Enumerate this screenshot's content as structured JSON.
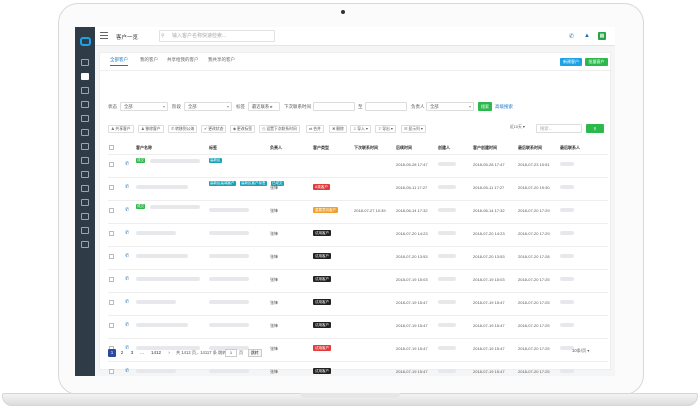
{
  "window": {
    "title": "客户一览",
    "search_placeholder": "输入客户名称快速检索..."
  },
  "header_icons": [
    "phone-icon",
    "bell-icon",
    "calendar-icon"
  ],
  "tabs": [
    {
      "label": "全部客户",
      "active": true
    },
    {
      "label": "我的客户",
      "active": false
    },
    {
      "label": "共享给我的客户",
      "active": false
    },
    {
      "label": "我共享的客户",
      "active": false
    }
  ],
  "actions": {
    "new_customer": "新建客户",
    "import_customer": "批量客户"
  },
  "filters": {
    "status_label": "状态",
    "status_value": "全部",
    "stage_label": "阶段",
    "stage_value": "全部",
    "tag_label": "标签",
    "tag_value": "最近联系 ▸",
    "next_contact_label": "下次联系时间",
    "to": "至",
    "owner_label": "负责人",
    "owner_value": "全部",
    "search_btn": "搜索",
    "advanced": "高级搜索"
  },
  "toolbar": [
    {
      "icon": "person-icon",
      "label": "共享客户"
    },
    {
      "icon": "person-icon",
      "label": "移除客户"
    },
    {
      "icon": "phone-icon",
      "label": "转移到公海"
    },
    {
      "icon": "check-icon",
      "label": "更改状态"
    },
    {
      "icon": "tag-icon",
      "label": "更改标签"
    },
    {
      "icon": "clock-icon",
      "label": "设置下次联系时间"
    },
    {
      "icon": "merge-icon",
      "label": "合并"
    },
    {
      "icon": "trash-icon",
      "label": "删除"
    },
    {
      "icon": "import-icon",
      "label": "导入"
    },
    {
      "icon": "export-icon",
      "label": "导出"
    },
    {
      "icon": "list-icon",
      "label": "显示列"
    }
  ],
  "view": {
    "sort_label": "近10天 ▾",
    "search_placeholder": "搜索..."
  },
  "columns": [
    "客户名称",
    "标签",
    "负责人",
    "客户类型",
    "下次联系时间",
    "后续时间",
    "创建人",
    "客户创建时间",
    "最后联系时间",
    "最后联系人"
  ],
  "rows": [
    {
      "name_tag": "成交",
      "name_tag_color": "#2db84b",
      "tags": [
        {
          "t": "高新区",
          "c": "#17a2b8"
        }
      ],
      "owner": "",
      "stage": "",
      "stage_color": "",
      "next": "",
      "follow": "2018-05-28 17:47",
      "creator": "",
      "created": "2018-05-28 17:47",
      "last": "2018-07-23 10:51",
      "label_blur": 0
    },
    {
      "name_tag": "",
      "name_tag_color": "",
      "tags": [
        {
          "t": "高新区高端客户",
          "c": "#17a2b8"
        },
        {
          "t": "高新区客户标签",
          "c": "#17a2b8"
        },
        {
          "t": "已成交",
          "c": "#17a2b8"
        }
      ],
      "owner": "张锋",
      "stage": "A类客户",
      "stage_color": "#e23b3b",
      "next": "",
      "follow": "2018-05-11 17:27",
      "creator": "",
      "created": "2018-05-11 17:27",
      "last": "2018-07-20 19:30",
      "label_blur": 0
    },
    {
      "name_tag": "成交",
      "name_tag_color": "#2db84b",
      "tags": [],
      "owner": "张锋",
      "stage": "重要意向客户",
      "stage_color": "#f0a030",
      "next": "2018-07-27 10:39",
      "follow": "2018-06-14 17:32",
      "creator": "",
      "created": "2018-06-14 17:32",
      "last": "2018-07-20 17:29",
      "label_blur": 1
    },
    {
      "name_tag": "",
      "name_tag_color": "",
      "tags": [],
      "owner": "张锋",
      "stage": "试用客户",
      "stage_color": "#222",
      "next": "",
      "follow": "2018-07-20 14:23",
      "creator": "",
      "created": "2018-07-20 14:23",
      "last": "2018-07-20 17:29",
      "label_blur": 1
    },
    {
      "name_tag": "",
      "name_tag_color": "",
      "tags": [],
      "owner": "张锋",
      "stage": "试用客户",
      "stage_color": "#222",
      "next": "",
      "follow": "2018-07-20 13:53",
      "creator": "",
      "created": "2018-07-20 13:53",
      "last": "2018-07-20 17:28",
      "label_blur": 1
    },
    {
      "name_tag": "",
      "name_tag_color": "",
      "tags": [],
      "owner": "张锋",
      "stage": "试用客户",
      "stage_color": "#222",
      "next": "",
      "follow": "2018-07-19 15:03",
      "creator": "",
      "created": "2018-07-19 15:03",
      "last": "2018-07-20 17:25",
      "label_blur": 1
    },
    {
      "name_tag": "",
      "name_tag_color": "",
      "tags": [],
      "owner": "张锋",
      "stage": "试用客户",
      "stage_color": "#222",
      "next": "",
      "follow": "2018-07-19 15:47",
      "creator": "",
      "created": "2018-07-19 15:47",
      "last": "2018-07-20 17:25",
      "label_blur": 1
    },
    {
      "name_tag": "",
      "name_tag_color": "",
      "tags": [],
      "owner": "张锋",
      "stage": "试用客户",
      "stage_color": "#222",
      "next": "",
      "follow": "2018-07-19 15:47",
      "creator": "",
      "created": "2018-07-19 15:47",
      "last": "2018-07-20 17:25",
      "label_blur": 1
    },
    {
      "name_tag": "",
      "name_tag_color": "",
      "tags": [],
      "owner": "张锋",
      "stage": "试用客户",
      "stage_color": "#e23b3b",
      "next": "",
      "follow": "2018-07-19 15:47",
      "creator": "",
      "created": "2018-07-19 15:47",
      "last": "2018-07-20 17:25",
      "label_blur": 1
    },
    {
      "name_tag": "",
      "name_tag_color": "",
      "tags": [],
      "owner": "张锋",
      "stage": "试用客户",
      "stage_color": "#222",
      "next": "",
      "follow": "2018-07-19 15:47",
      "creator": "",
      "created": "2018-07-19 15:47",
      "last": "2018-07-20 17:25",
      "label_blur": 1
    }
  ],
  "pager": {
    "pages": [
      "1",
      "2",
      "3",
      "...",
      "1412"
    ],
    "summary": "共 1412 页，14117 条 跳转到",
    "page_input": "1",
    "page_unit": "页",
    "go": "跳转",
    "page_size": "10条/页 ▾"
  },
  "colors": {
    "sidebar": "#2f3b47",
    "accent": "#1ba3e6",
    "success": "#2db84b",
    "pager_active": "#2d4a9e"
  }
}
